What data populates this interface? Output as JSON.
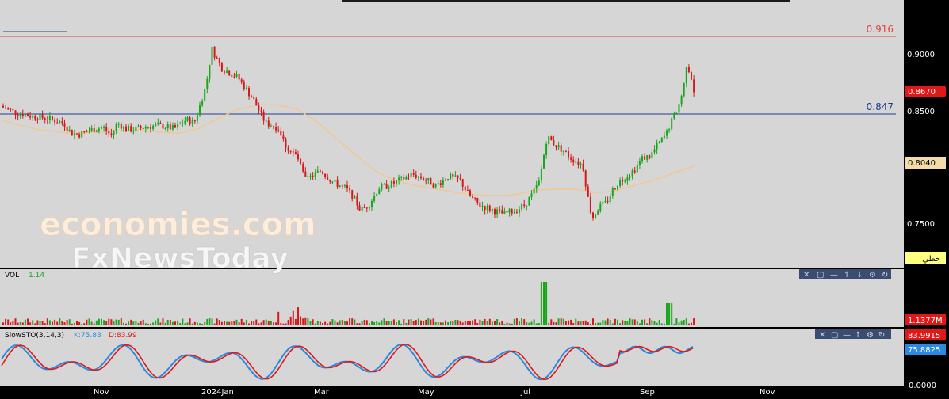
{
  "chart_data": [
    {
      "type": "candlestick",
      "x_ticks": [
        "Nov",
        "2024Jan",
        "Mar",
        "May",
        "Jul",
        "Sep",
        "Nov"
      ],
      "y_ticks": [
        "0.9000",
        "0.8500",
        "0.7500"
      ],
      "ylim": [
        0.715,
        0.95
      ],
      "grid": false,
      "reference_lines": [
        {
          "label": "0.916",
          "value": 0.916,
          "color": "#e24444"
        },
        {
          "label": "0.847",
          "value": 0.847,
          "color": "#1f3f8f"
        }
      ],
      "price_tags": [
        {
          "label": "0.8670",
          "value": 0.867,
          "color": "#e01818"
        },
        {
          "label": "0.8040",
          "value": 0.804,
          "color": "#f4dca8"
        }
      ],
      "moving_average": {
        "color": "#f0c890",
        "values": [
          [
            0,
            0.845
          ],
          [
            25,
            0.84
          ],
          [
            50,
            0.836
          ],
          [
            75,
            0.834
          ],
          [
            100,
            0.833
          ],
          [
            125,
            0.834
          ],
          [
            150,
            0.835
          ],
          [
            175,
            0.836
          ],
          [
            200,
            0.834
          ],
          [
            225,
            0.833
          ],
          [
            250,
            0.837
          ],
          [
            275,
            0.846
          ],
          [
            300,
            0.854
          ],
          [
            325,
            0.858
          ],
          [
            350,
            0.858
          ],
          [
            375,
            0.854
          ],
          [
            400,
            0.843
          ],
          [
            425,
            0.828
          ],
          [
            450,
            0.813
          ],
          [
            475,
            0.799
          ],
          [
            500,
            0.791
          ],
          [
            525,
            0.787
          ],
          [
            550,
            0.784
          ],
          [
            575,
            0.781
          ],
          [
            600,
            0.779
          ],
          [
            625,
            0.778
          ],
          [
            650,
            0.779
          ],
          [
            675,
            0.783
          ],
          [
            700,
            0.784
          ],
          [
            725,
            0.784
          ],
          [
            750,
            0.781
          ],
          [
            775,
            0.782
          ],
          [
            800,
            0.787
          ],
          [
            825,
            0.792
          ],
          [
            850,
            0.798
          ],
          [
            875,
            0.804
          ]
        ]
      },
      "badge": "خطي"
    },
    {
      "type": "bar",
      "name": "VOL",
      "label": "VOL",
      "value_label": "1.14",
      "last_value_tag": "1.1377M"
    },
    {
      "type": "line",
      "name": "SlowSTO(3,14,3)",
      "label": "SlowSTO(3,14,3)",
      "k_label": "K:75.88",
      "d_label": "D:83.99",
      "tags": [
        "83.9915",
        "75.8825",
        "0.0000"
      ],
      "ylim": [
        0,
        100
      ]
    }
  ],
  "watermark": {
    "line1": "economies.com",
    "line2": "FxNewsToday"
  },
  "colors": {
    "up": "#1aa51a",
    "down": "#d81818",
    "k": "#2a8ae0",
    "d": "#e01818"
  }
}
